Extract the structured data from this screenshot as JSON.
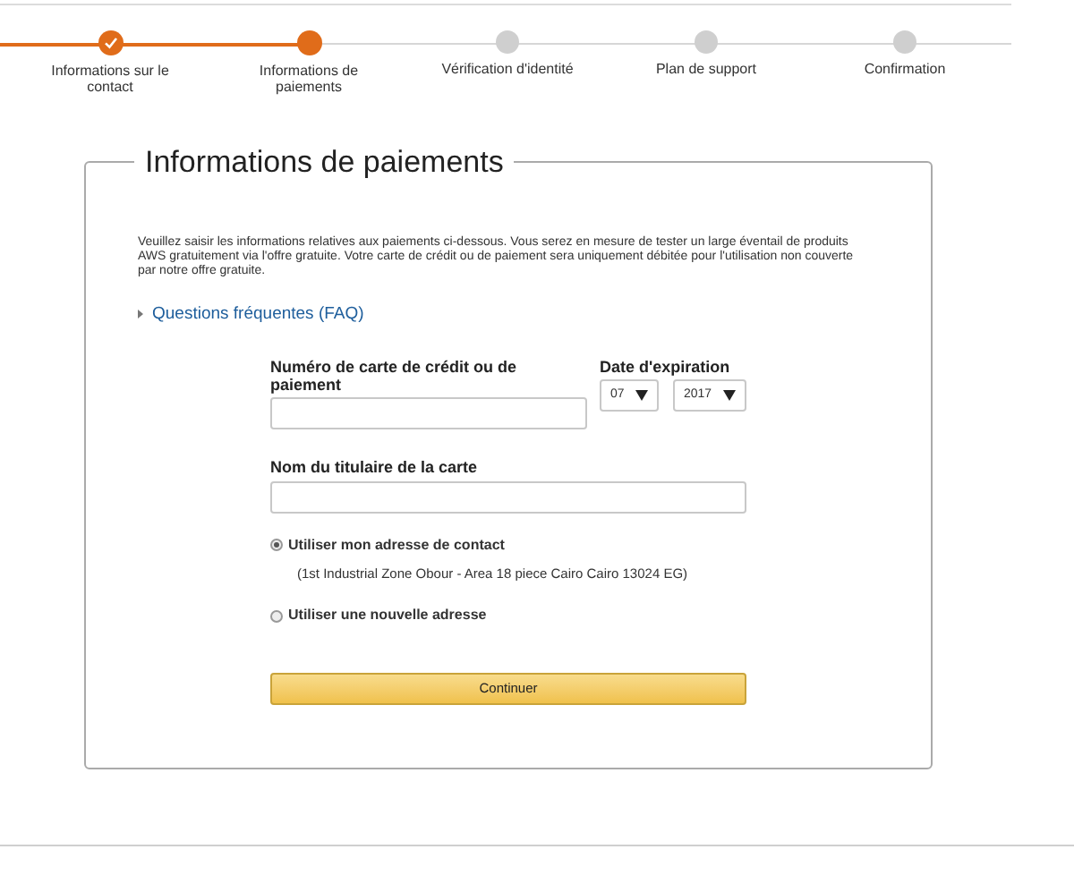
{
  "steps": [
    {
      "label": "Informations sur le contact",
      "completed": true,
      "selected": false
    },
    {
      "label": "Informations de paiements",
      "completed": false,
      "selected": true
    },
    {
      "label": "Vérification d'identité",
      "completed": false,
      "selected": false
    },
    {
      "label": "Plan de support",
      "completed": false,
      "selected": false
    },
    {
      "label": "Confirmation",
      "completed": false,
      "selected": false
    }
  ],
  "panel": {
    "title": "Informations de paiements",
    "intro": "Veuillez saisir les informations relatives aux paiements ci-dessous. Vous serez en mesure de tester un large éventail de produits AWS gratuitement via l'offre gratuite. Votre carte de crédit ou de paiement sera uniquement débitée pour l'utilisation non couverte par notre offre gratuite.",
    "faq_link": "Questions fréquentes (FAQ)",
    "card_number": {
      "label": "Numéro de carte de crédit ou de paiement"
    },
    "expiration": {
      "label": "Date d'expiration",
      "month": "07",
      "year": "2017"
    },
    "cardholder": {
      "label": "Nom du titulaire de la carte"
    },
    "address_options": [
      {
        "label": "Utiliser mon adresse de contact",
        "detail": "(1st Industrial Zone Obour - Area 18 piece Cairo Cairo 13024 EG)",
        "selected": true
      },
      {
        "label": "Utiliser une nouvelle adresse",
        "selected": false
      }
    ],
    "submit": "Continuer"
  }
}
